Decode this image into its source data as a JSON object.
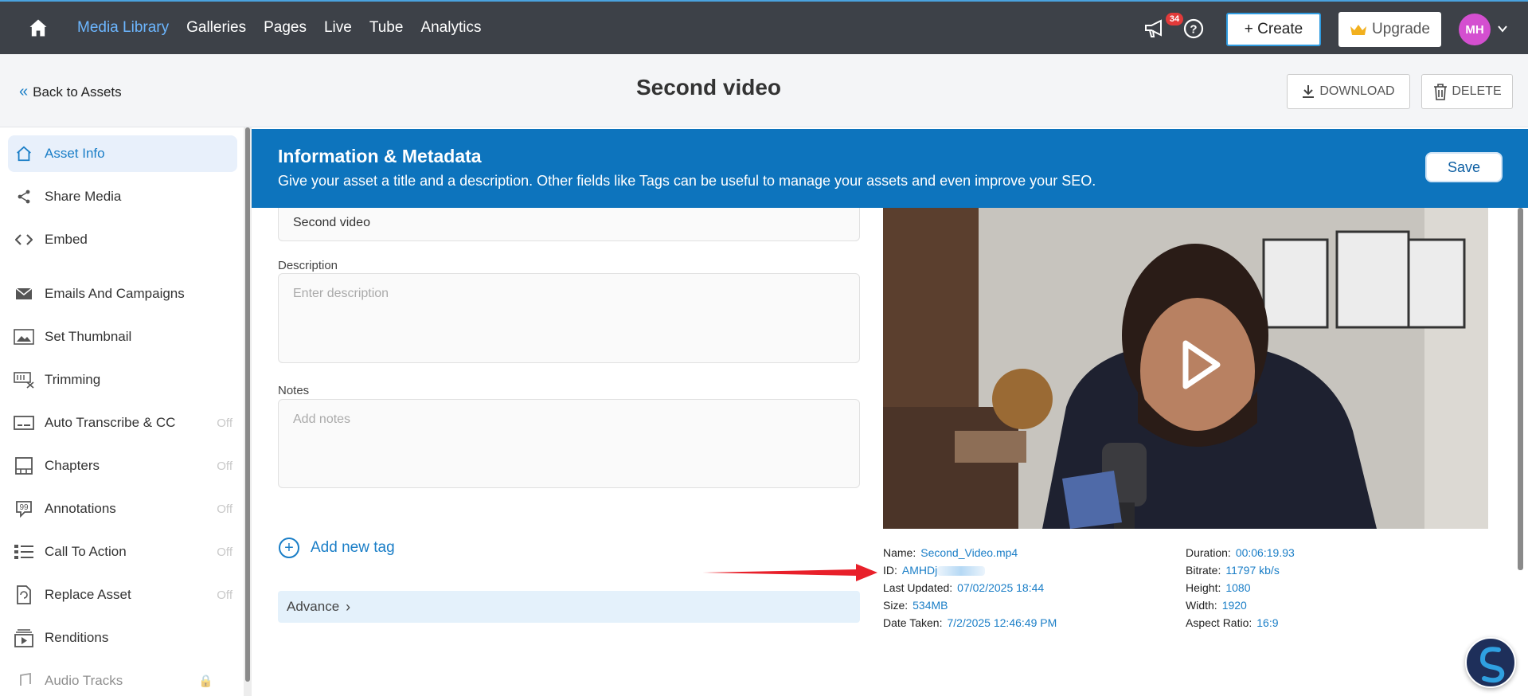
{
  "nav": {
    "links": [
      "Media Library",
      "Galleries",
      "Pages",
      "Live",
      "Tube",
      "Analytics"
    ],
    "active": "Media Library",
    "notification_count": "34",
    "create_label": "+ Create",
    "upgrade_label": "Upgrade",
    "avatar_initials": "MH"
  },
  "subheader": {
    "back_label": "Back to Assets",
    "title": "Second video",
    "download_label": "DOWNLOAD",
    "delete_label": "DELETE"
  },
  "sidebar": {
    "items": [
      {
        "label": "Asset Info",
        "icon": "home-icon",
        "status": "",
        "active": true
      },
      {
        "label": "Share Media",
        "icon": "share-icon",
        "status": ""
      },
      {
        "label": "Embed",
        "icon": "code-icon",
        "status": ""
      },
      {
        "label": "Emails And Campaigns",
        "icon": "envelope-icon",
        "status": ""
      },
      {
        "label": "Set Thumbnail",
        "icon": "image-icon",
        "status": ""
      },
      {
        "label": "Trimming",
        "icon": "scissors-icon",
        "status": ""
      },
      {
        "label": "Auto Transcribe & CC",
        "icon": "captions-icon",
        "status": "Off"
      },
      {
        "label": "Chapters",
        "icon": "chapters-icon",
        "status": "Off"
      },
      {
        "label": "Annotations",
        "icon": "annotation-icon",
        "status": "Off"
      },
      {
        "label": "Call To Action",
        "icon": "list-icon",
        "status": "Off"
      },
      {
        "label": "Replace Asset",
        "icon": "replace-icon",
        "status": "Off"
      },
      {
        "label": "Renditions",
        "icon": "renditions-icon",
        "status": ""
      },
      {
        "label": "Audio Tracks",
        "icon": "audio-icon",
        "status": ""
      }
    ]
  },
  "banner": {
    "title": "Information & Metadata",
    "description": "Give your asset a title and a description. Other fields like Tags can be useful to manage your assets and even improve your SEO.",
    "save_label": "Save"
  },
  "form": {
    "title_value": "Second video",
    "description_label": "Description",
    "description_placeholder": "Enter description",
    "notes_label": "Notes",
    "notes_placeholder": "Add notes",
    "add_tag_label": "Add new tag",
    "advance_label": "Advance"
  },
  "metadata": {
    "left": [
      {
        "key": "Name:",
        "value": "Second_Video.mp4"
      },
      {
        "key": "ID:",
        "value": "AMHDj"
      },
      {
        "key": "Last Updated:",
        "value": "07/02/2025 18:44"
      },
      {
        "key": "Size:",
        "value": "534MB"
      },
      {
        "key": "Date Taken:",
        "value": "7/2/2025 12:46:49 PM"
      }
    ],
    "right": [
      {
        "key": "Duration:",
        "value": "00:06:19.93"
      },
      {
        "key": "Bitrate:",
        "value": "11797 kb/s"
      },
      {
        "key": "Height:",
        "value": "1080"
      },
      {
        "key": "Width:",
        "value": "1920"
      },
      {
        "key": "Aspect Ratio:",
        "value": "16:9"
      }
    ]
  },
  "colors": {
    "nav_bg": "#3d4148",
    "accent": "#0d74bd",
    "link": "#1a7ec7",
    "arrow": "#e8202a"
  }
}
